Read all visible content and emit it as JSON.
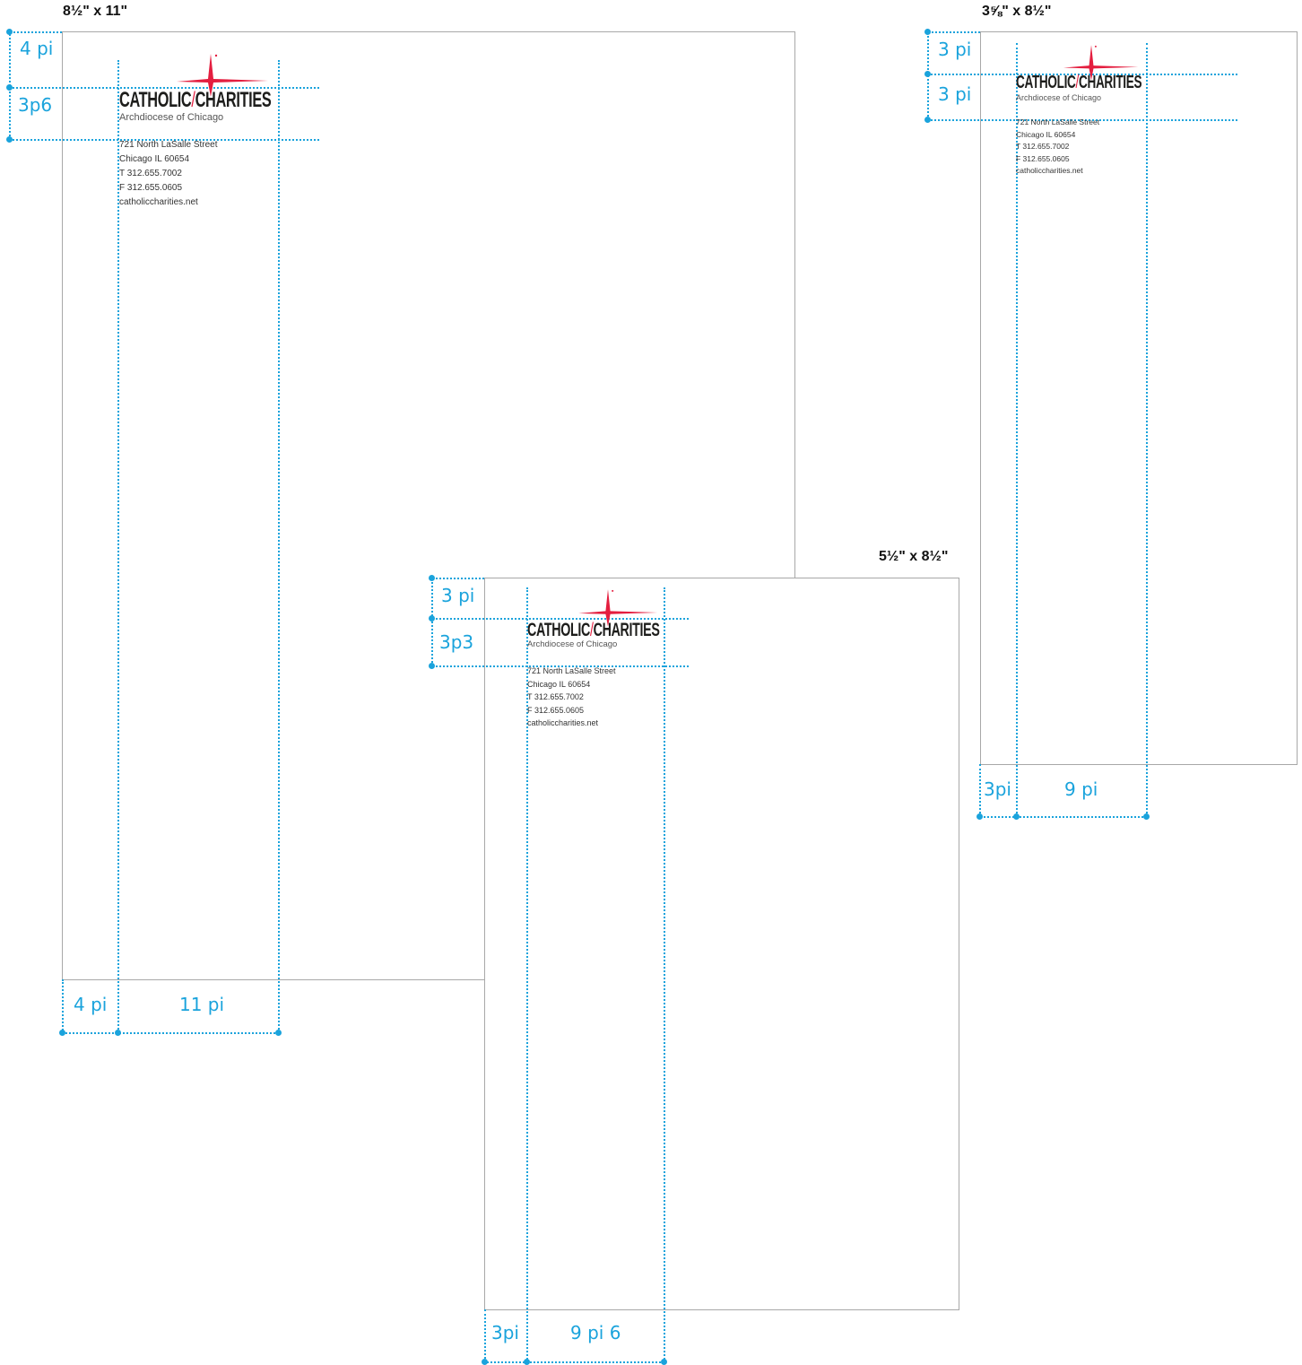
{
  "sizes": {
    "letter": "8½\" x 11\"",
    "narrow": "3⅝\" x 8½\"",
    "half": "5½\" x 8½\""
  },
  "letterhead": {
    "wordmark_left": "CATHOLIC",
    "wordmark_right": "CHARITIES",
    "registered": "®",
    "subline": "Archdiocese of Chicago",
    "address": [
      "721 North LaSalle Street",
      "Chicago IL 60654",
      "T 312.655.7002",
      "F 312.655.0605",
      "catholiccharities.net"
    ]
  },
  "measurements": {
    "letter": {
      "top": "4 pi",
      "second": "3p6",
      "left": "4 pi",
      "width": "11 pi"
    },
    "narrow": {
      "top": "3 pi",
      "second": "3 pi",
      "left": "3pi",
      "width": "9 pi"
    },
    "half": {
      "top": "3 pi",
      "second": "3p3",
      "left": "3pi",
      "width": "9 pi 6"
    }
  },
  "colors": {
    "guide": "#1aa3dc",
    "accent": "#e41e3f",
    "wordmark": "#1d1d1b",
    "page_border": "#a8a8a8"
  }
}
